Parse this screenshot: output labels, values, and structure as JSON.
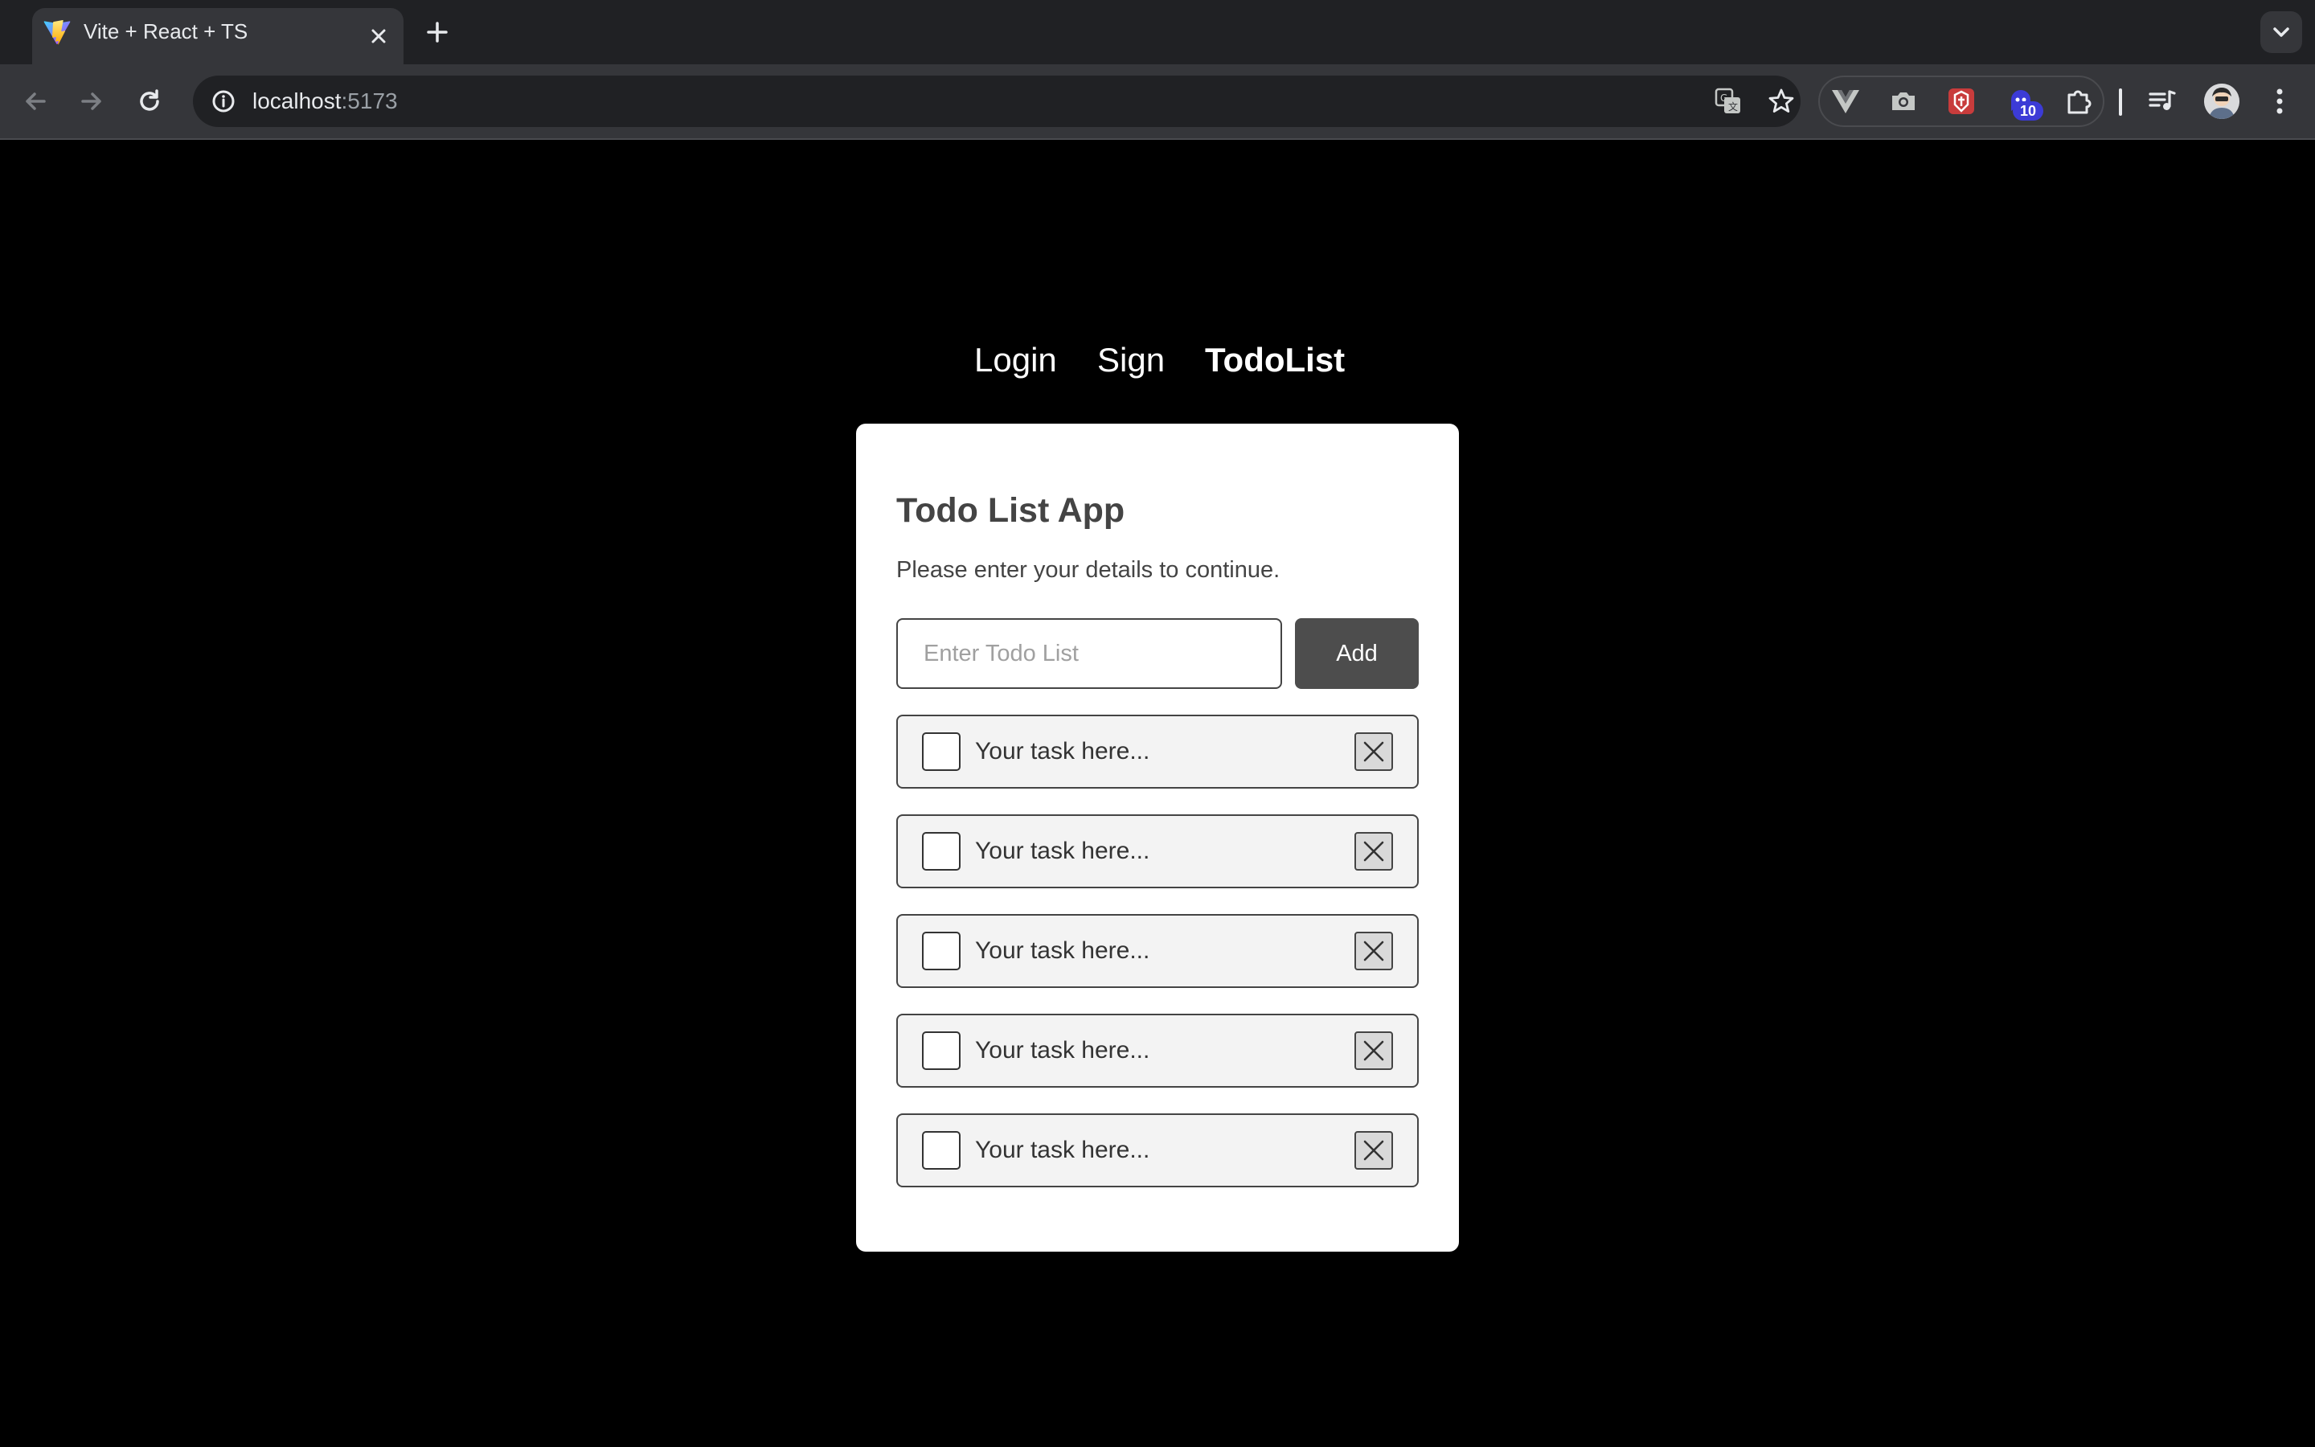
{
  "browser": {
    "tab_title": "Vite + React + TS",
    "url_host": "localhost",
    "url_port": ":5173",
    "extension_badge": "10",
    "colors": {
      "chrome_dark": "#202124",
      "chrome_toolbar": "#35363a",
      "badge": "#3c3bd6"
    }
  },
  "nav": {
    "links": [
      {
        "label": "Login",
        "active": false
      },
      {
        "label": "Sign",
        "active": false
      },
      {
        "label": "TodoList",
        "active": true
      }
    ]
  },
  "card": {
    "title": "Todo List App",
    "subtitle": "Please enter your details to continue.",
    "input_placeholder": "Enter Todo List",
    "input_value": "",
    "add_label": "Add",
    "todos": [
      {
        "text": "Your task here...",
        "checked": false
      },
      {
        "text": "Your task here...",
        "checked": false
      },
      {
        "text": "Your task here...",
        "checked": false
      },
      {
        "text": "Your task here...",
        "checked": false
      },
      {
        "text": "Your task here...",
        "checked": false
      }
    ]
  },
  "colors": {
    "page_bg": "#000000",
    "card_bg": "#ffffff",
    "button_bg": "#4d4d4d",
    "item_bg": "#f3f3f3"
  }
}
